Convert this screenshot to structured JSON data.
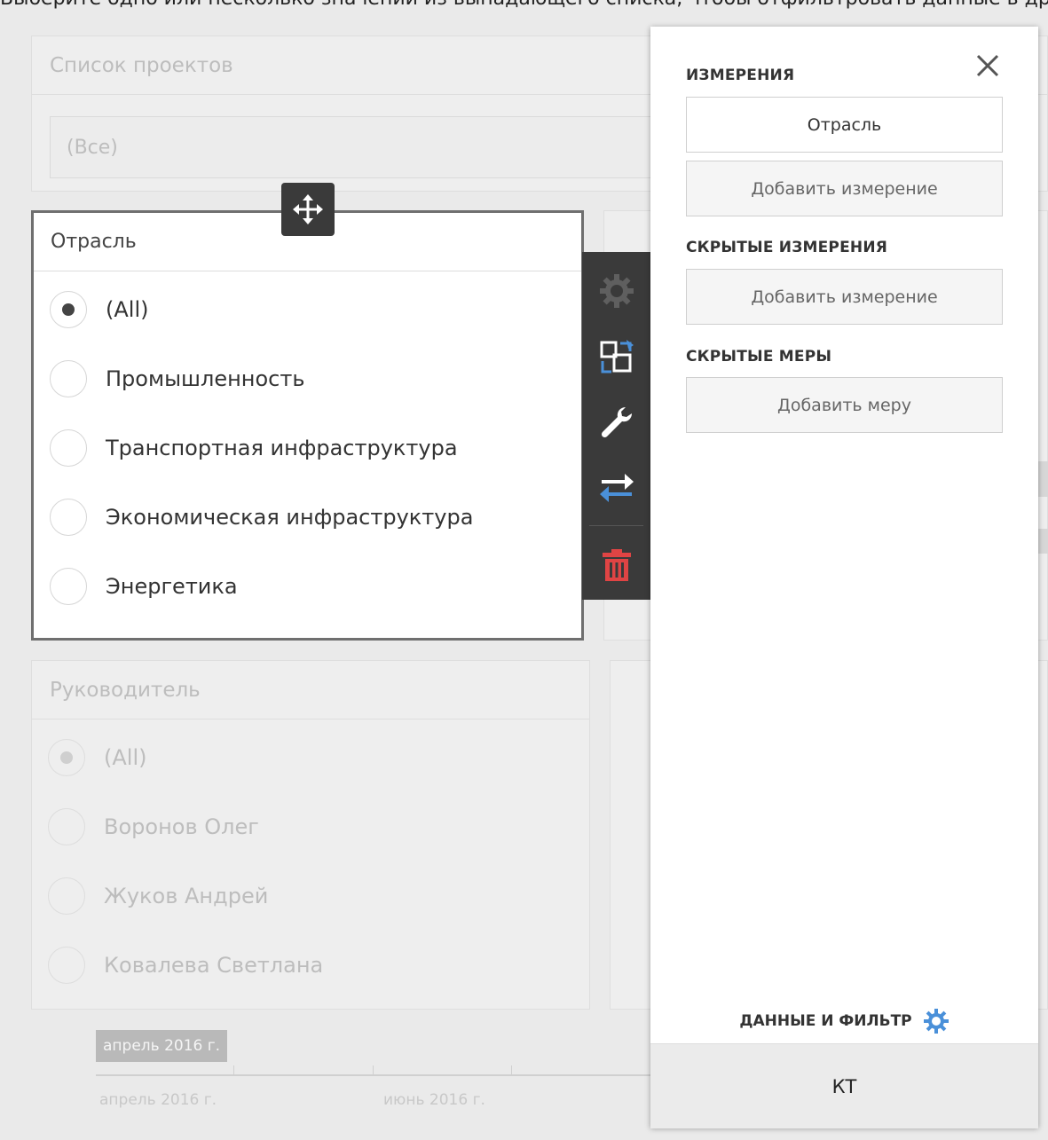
{
  "top_cropped_text": "Выберите одно или несколько значений из выпадающего списка, чтобы отфильтровать данные в других элементах",
  "background": {
    "project_list_panel": {
      "title": "Список проектов",
      "value": "(Все)"
    },
    "leader_panel": {
      "title": "Руководитель",
      "options": [
        {
          "label": "(All)",
          "selected": true
        },
        {
          "label": "Воронов Олег",
          "selected": false
        },
        {
          "label": "Жуков Андрей",
          "selected": false
        },
        {
          "label": "Ковалева Светлана",
          "selected": false
        }
      ]
    },
    "timeline": {
      "badge": "апрель 2016 г.",
      "labels": [
        "апрель 2016 г.",
        "июнь 2016 г."
      ]
    }
  },
  "selected_panel": {
    "title": "Отрасль",
    "options": [
      {
        "label": "(All)",
        "selected": true
      },
      {
        "label": "Промышленность",
        "selected": false
      },
      {
        "label": "Транспортная инфраструктура",
        "selected": false
      },
      {
        "label": "Экономическая инфраструктура",
        "selected": false
      },
      {
        "label": "Энергетика",
        "selected": false
      }
    ]
  },
  "toolbar": {
    "icons": [
      "gear-icon",
      "convert-icon",
      "wrench-icon",
      "swap-icon",
      "trash-icon"
    ]
  },
  "side_panel": {
    "dimensions_title": "ИЗМЕРЕНИЯ",
    "dimension_value": "Отрасль",
    "add_dimension": "Добавить измерение",
    "hidden_dimensions_title": "СКРЫТЫЕ ИЗМЕРЕНИЯ",
    "add_hidden_dimension": "Добавить измерение",
    "hidden_measures_title": "СКРЫТЫЕ МЕРЫ",
    "add_measure": "Добавить меру",
    "data_filter_label": "ДАННЫЕ И ФИЛЬТР",
    "bottom_tab": "КТ"
  },
  "colors": {
    "accent_blue": "#4a90d9",
    "delete_red": "#e04444",
    "toolbar_bg": "#3a3a3a"
  }
}
